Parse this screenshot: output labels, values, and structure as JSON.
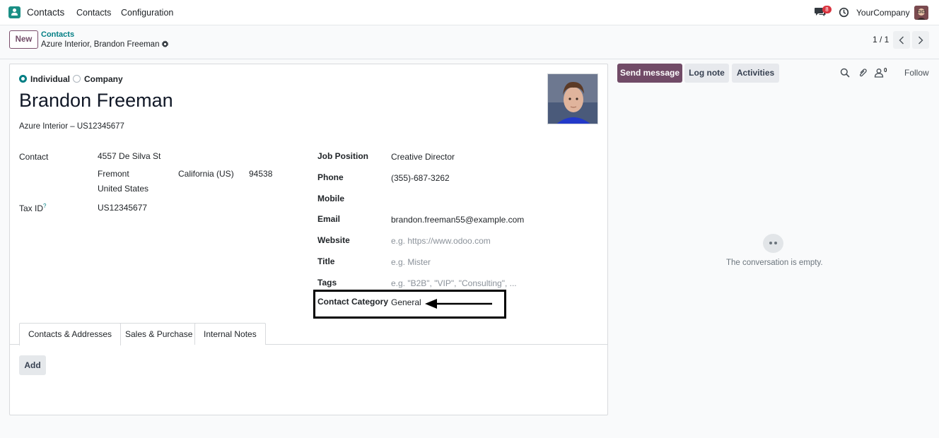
{
  "navbar": {
    "app_name": "Contacts",
    "menu": [
      "Contacts",
      "Configuration"
    ],
    "message_count": "8",
    "company": "YourCompany"
  },
  "control_panel": {
    "new_label": "New",
    "breadcrumb_parent": "Contacts",
    "breadcrumb_current": "Azure Interior, Brandon Freeman",
    "pager": "1 / 1"
  },
  "form": {
    "type_options": [
      {
        "label": "Individual",
        "selected": true
      },
      {
        "label": "Company",
        "selected": false
      }
    ],
    "name": "Brandon Freeman",
    "company_line": "Azure Interior – US12345677",
    "address": {
      "label": "Contact",
      "street": "4557 De Silva St",
      "city": "Fremont",
      "state": "California (US)",
      "zip": "94538",
      "country": "United States"
    },
    "tax_id": {
      "label": "Tax ID",
      "help": "?",
      "value": "US12345677"
    },
    "right_fields": [
      {
        "label": "Job Position",
        "value": "Creative Director",
        "placeholder": ""
      },
      {
        "label": "Phone",
        "value": "(355)-687-3262",
        "placeholder": ""
      },
      {
        "label": "Mobile",
        "value": "",
        "placeholder": ""
      },
      {
        "label": "Email",
        "value": "brandon.freeman55@example.com",
        "placeholder": ""
      },
      {
        "label": "Website",
        "value": "",
        "placeholder": "e.g. https://www.odoo.com"
      },
      {
        "label": "Title",
        "value": "",
        "placeholder": "e.g. Mister"
      },
      {
        "label": "Tags",
        "value": "",
        "placeholder": "e.g. \"B2B\", \"VIP\", \"Consulting\", ..."
      },
      {
        "label": "Contact Category",
        "value": "General",
        "placeholder": ""
      }
    ],
    "tabs": [
      "Contacts & Addresses",
      "Sales & Purchase",
      "Internal Notes"
    ],
    "add_label": "Add"
  },
  "chatter": {
    "send_message": "Send message",
    "log_note": "Log note",
    "activities": "Activities",
    "followers": "0",
    "follow": "Follow",
    "empty_text": "The conversation is empty."
  },
  "colors": {
    "brand": "#714b67",
    "accent": "#017e84",
    "badge": "#d9343f"
  }
}
